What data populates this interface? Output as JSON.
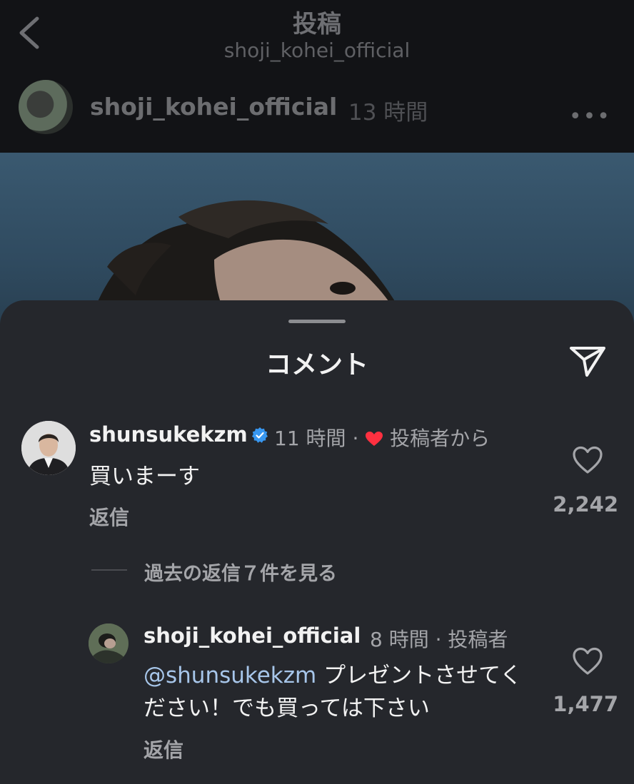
{
  "header": {
    "title": "投稿",
    "subtitle": "shoji_kohei_official"
  },
  "post": {
    "username": "shoji_kohei_official",
    "time": "13 時間",
    "more_label": "•••"
  },
  "sheet": {
    "title": "コメント"
  },
  "comments": [
    {
      "username": "shunsukekzm",
      "verified": true,
      "time": "11 時間",
      "separator": "·",
      "liked_by_author_label": "投稿者から",
      "text": "買いまーす",
      "reply_label": "返信",
      "likes": "2,242"
    }
  ],
  "view_more_label": "過去の返信７件を見る",
  "replies": [
    {
      "username": "shoji_kohei_official",
      "meta": "8 時間 · 投稿者",
      "mention": "@shunsukekzm",
      "text": " プレゼントさせてください！でも買っては下さい",
      "reply_label": "返信",
      "likes": "1,477"
    }
  ],
  "colors": {
    "sheet_bg": "#25272c",
    "accent_blue": "#3897f0",
    "heart_red": "#ff3040",
    "mention": "#a7c6ea"
  },
  "icons": [
    "chevron-left-icon",
    "more-icon",
    "share-icon",
    "verified-icon",
    "heart-icon",
    "heart-outline-icon"
  ]
}
